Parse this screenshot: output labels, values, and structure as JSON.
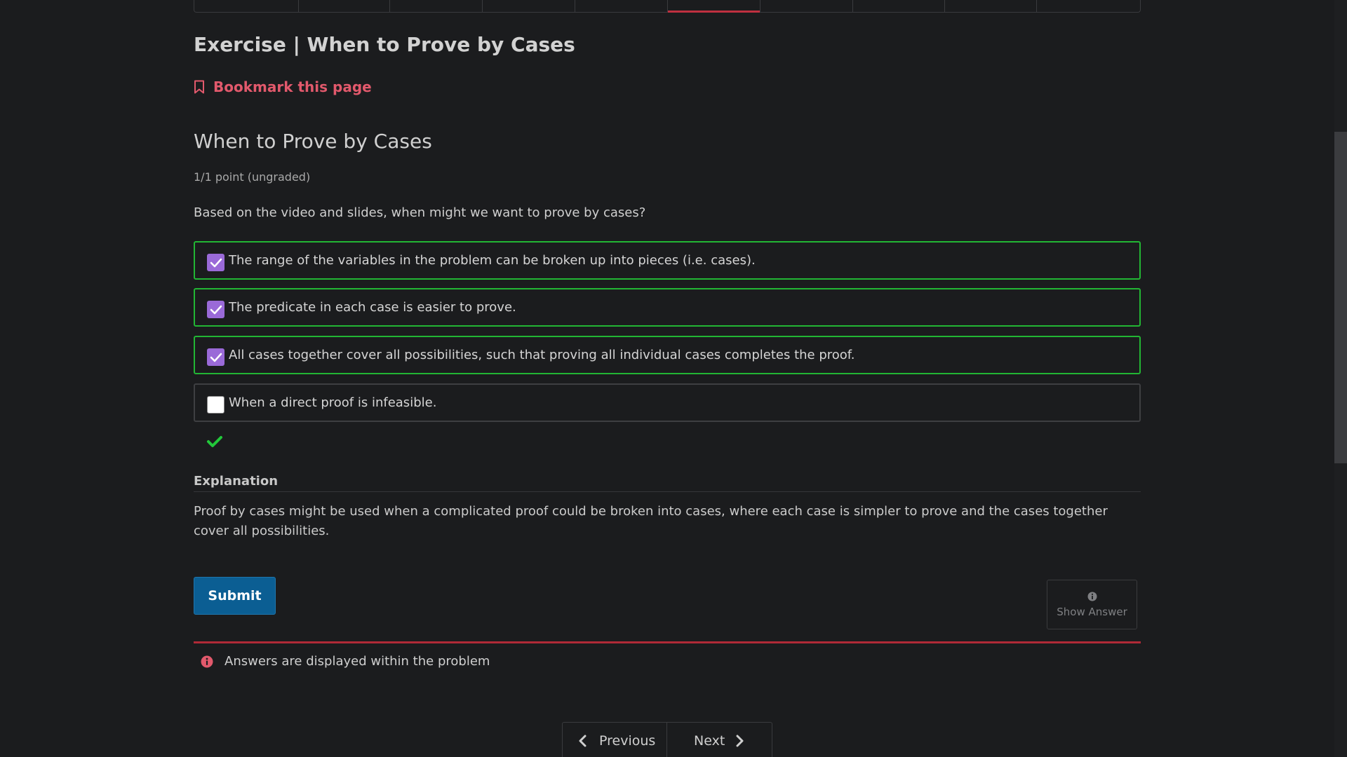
{
  "sequence_nav": {
    "tab_widths": [
      149,
      130,
      132,
      132,
      132,
      132,
      132,
      131,
      131,
      132
    ],
    "active_index": 5
  },
  "header": {
    "unit_title": "Exercise | When to Prove by Cases",
    "bookmark_label": "Bookmark this page"
  },
  "problem": {
    "title": "When to Prove by Cases",
    "points": "1/1 point (ungraded)",
    "question": "Based on the video and slides, when might we want to prove by cases?",
    "choices": [
      {
        "label": "The range of the variables in the problem can be broken up into pieces (i.e. cases).",
        "checked": true
      },
      {
        "label": "The predicate in each case is easier to prove.",
        "checked": true
      },
      {
        "label": "All cases together cover all possibilities, such that proving all individual cases completes the proof.",
        "checked": true
      },
      {
        "label": "When a direct proof is infeasible.",
        "checked": false
      }
    ],
    "status": "correct"
  },
  "explanation": {
    "title": "Explanation",
    "text": "Proof by cases might be used when a complicated proof could be broken into cases, where each case is simpler to prove and the cases together cover all possibilities."
  },
  "actions": {
    "submit_label": "Submit",
    "show_answer_label": "Show Answer"
  },
  "notice": {
    "text": "Answers are displayed within the problem"
  },
  "pager": {
    "previous_label": "Previous",
    "next_label": "Next"
  },
  "colors": {
    "background": "#1b1c1e",
    "accent_red": "#e2596c",
    "correct_green": "#22b634",
    "checkbox_purple": "#9a6ad8",
    "submit_blue": "#0b5e93"
  }
}
